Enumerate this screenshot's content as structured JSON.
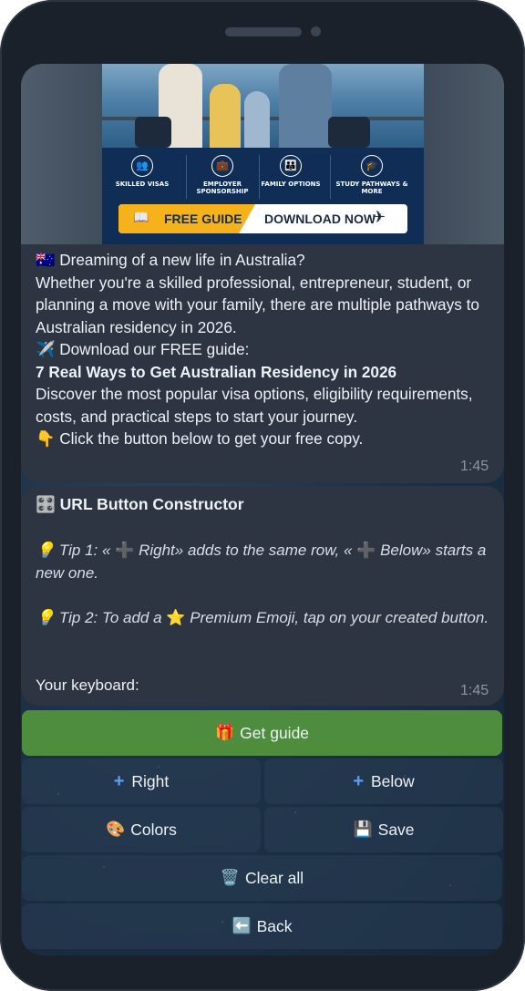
{
  "banner": {
    "features": [
      {
        "icon": "people-icon",
        "label": "SKILLED VISAS"
      },
      {
        "icon": "briefcase-icon",
        "label": "EMPLOYER SPONSORSHIP"
      },
      {
        "icon": "family-icon",
        "label": "FAMILY OPTIONS"
      },
      {
        "icon": "graduation-cap-icon",
        "label": "STUDY PATHWAYS & MORE"
      }
    ],
    "cta_free": "FREE GUIDE",
    "cta_download": "DOWNLOAD NOW"
  },
  "message1": {
    "flag": "🇦🇺",
    "line1": "Dreaming of a new life in Australia?",
    "para": "Whether you're a skilled professional, entrepreneur, student, or planning a move with your family, there are multiple pathways to Australian residency in 2026.",
    "plane": "✈️",
    "download": "Download our FREE guide:",
    "bold_title": "7 Real Ways to Get Australian Residency in 2026",
    "discover": "Discover the most popular visa options, eligibility requirements, costs, and practical steps to start your journey.",
    "point": "👇",
    "click": "Click the button below to get your free copy.",
    "time": "1:45"
  },
  "message2": {
    "title_emoji": "🎛️",
    "title": "URL Button Constructor",
    "tip1_bulb": "💡",
    "tip1_a": "Tip 1: «",
    "tip1_right": "Right» adds to the same row, «",
    "tip1_below": "Below» starts a new one.",
    "tip2_bulb": "💡",
    "tip2_a": "Tip 2: To add a",
    "tip2_b": "Premium Emoji, tap on your created button.",
    "keyboard": "Your keyboard:",
    "time": "1:45"
  },
  "keyboard": {
    "get_guide": {
      "emoji": "🎁",
      "label": "Get guide"
    },
    "right": "Right",
    "below": "Below",
    "colors": {
      "emoji": "🎨",
      "label": "Colors"
    },
    "save": {
      "emoji": "💾",
      "label": "Save"
    },
    "clear": {
      "emoji": "🗑️",
      "label": "Clear all"
    },
    "back": {
      "emoji": "⬅️",
      "label": "Back"
    }
  },
  "colors": {
    "bubble": "#2c3541",
    "accent_green": "#4f8d3e",
    "plus_blue": "#5d9dff",
    "banner_navy": "#0f2d55",
    "banner_yellow": "#f6b21a"
  }
}
